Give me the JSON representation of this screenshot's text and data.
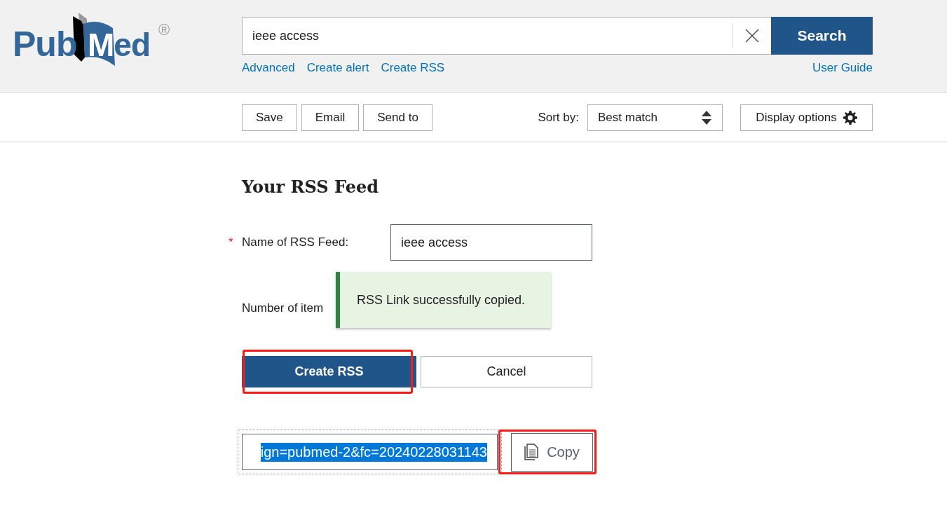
{
  "header": {
    "logo": {
      "part_1": "Pub",
      "part_2": "Med",
      "mark": "®"
    },
    "search": {
      "value": "ieee access"
    },
    "search_button": "Search",
    "links": [
      "Advanced",
      "Create alert",
      "Create RSS"
    ],
    "user_guide": "User Guide"
  },
  "toolbar": {
    "buttons": [
      "Save",
      "Email",
      "Send to"
    ],
    "sort_label": "Sort by:",
    "sort_value": "Best match",
    "display_options": "Display options"
  },
  "rss_form": {
    "title": "Your RSS Feed",
    "fields": [
      {
        "label": "Name of RSS Feed:",
        "required_mark": "*",
        "value": "ieee access"
      },
      {
        "label": "Number of item"
      }
    ],
    "buttons": [
      {
        "kind": "primary",
        "label": "Create RSS",
        "highlighted": true
      },
      {
        "kind": "secondary",
        "label": "Cancel",
        "highlighted": false
      }
    ],
    "link_field": {
      "value": "ign=pubmed-2&fc=20240228031143",
      "text_selected": true,
      "focused": true
    },
    "copy_button": {
      "label": "Copy",
      "highlighted": true
    }
  },
  "toast": {
    "message": "RSS Link successfully copied."
  }
}
